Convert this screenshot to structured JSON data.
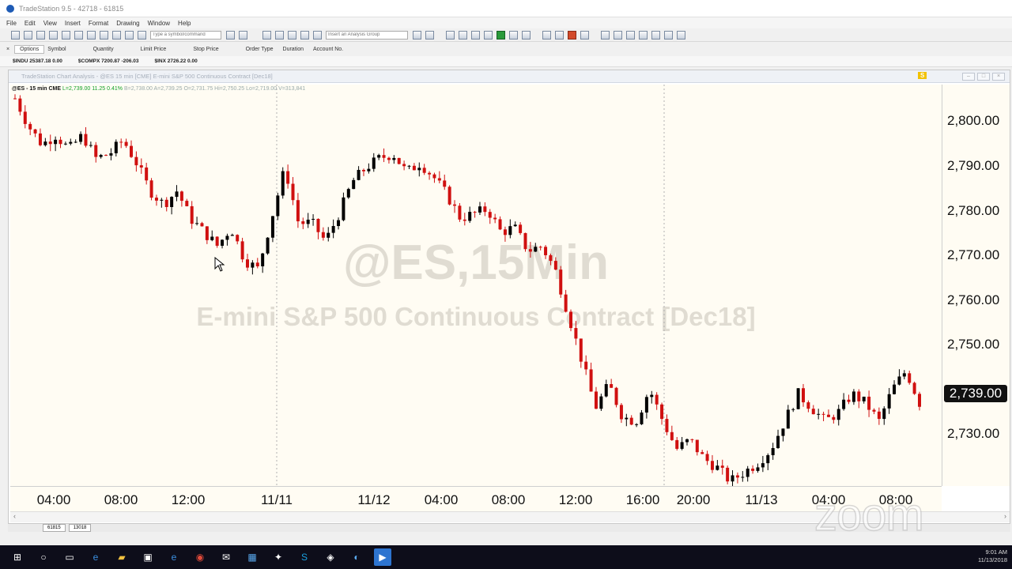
{
  "app": {
    "title": "TradeStation 9.5 - 42718 - 61815",
    "menu": [
      "File",
      "Edit",
      "View",
      "Insert",
      "Format",
      "Drawing",
      "Window",
      "Help"
    ],
    "symbol_box_placeholder": "Type a symbol/command",
    "analysis_group_placeholder": "Insert an Analysis Group"
  },
  "orderbar": {
    "tabs": [
      "Options",
      "Symbol"
    ],
    "fields": [
      "Quantity",
      "Limit Price",
      "Stop Price",
      "Order Type",
      "Duration",
      "Account No."
    ]
  },
  "quotes": [
    "$INDU 25387.18 0.00",
    "$COMPX 7200.87 -206.03",
    "$INX 2726.22 0.00"
  ],
  "chart": {
    "window_title": "TradeStation Chart Analysis - @ES 15 min [CME] E-mini S&P 500 Continuous Contract [Dec18]",
    "info_symbol": "@ES - 15 min  CME",
    "info_change": "L=2,739.00  11.25  0.41%",
    "info_rest": "B=2,738.00  A=2,739.25  O=2,731.75  Hi=2,750.25  Lo=2,719.00  V=313,841",
    "watermark_symbol": "@ES,15Min",
    "watermark_desc": "E-mini S&P 500 Continuous Contract [Dec18]",
    "s_badge": "S",
    "current_price": "2,739.00",
    "bottom_tabs": [
      "61815",
      "13018"
    ]
  },
  "chart_data": {
    "type": "candlestick",
    "price_axis_labels": [
      "2,800.00",
      "2,790.00",
      "2,780.00",
      "2,770.00",
      "2,760.00",
      "2,750.00",
      "2,739.00",
      "2,730.00"
    ],
    "price_axis_range": [
      2721,
      2808
    ],
    "time_axis_labels": [
      "04:00",
      "08:00",
      "12:00",
      "11/11",
      "11/12",
      "04:00",
      "08:00",
      "12:00",
      "16:00",
      "20:00",
      "11/13",
      "04:00",
      "08:00"
    ],
    "session_separators": [
      "11/11",
      "11/12 16:00"
    ],
    "colors": {
      "up": "#000000",
      "down": "#d01010",
      "background": "#fffcf3"
    },
    "close_path": [
      2805,
      2799,
      2795,
      2797,
      2794,
      2797,
      2792,
      2793,
      2796,
      2791,
      2785,
      2782,
      2785,
      2779,
      2776,
      2773,
      2777,
      2770,
      2768,
      2779,
      2790,
      2778,
      2778,
      2774,
      2780,
      2787,
      2790,
      2792,
      2793,
      2789,
      2791,
      2788,
      2784,
      2779,
      2780,
      2781,
      2776,
      2777,
      2772,
      2773,
      2768,
      2758,
      2748,
      2738,
      2743,
      2736,
      2735,
      2742,
      2735,
      2729,
      2731,
      2727,
      2725,
      2722,
      2724,
      2726,
      2729,
      2735,
      2741,
      2738,
      2735,
      2737,
      2741,
      2739,
      2735,
      2742,
      2746,
      2739
    ]
  },
  "taskbar": {
    "time": "9:01 AM",
    "date": "11/13/2018"
  },
  "zoom_watermark": "zoom"
}
